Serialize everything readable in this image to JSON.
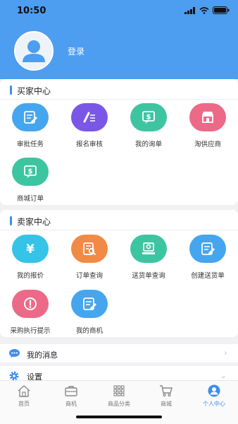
{
  "status": {
    "time": "10:50"
  },
  "profile": {
    "login_label": "登录"
  },
  "buyer": {
    "title": "买家中心",
    "items": [
      {
        "label": "审批任务",
        "icon": "approval-icon",
        "color": "#45a6ef"
      },
      {
        "label": "报名审核",
        "icon": "signup-review-icon",
        "color": "#7a57e6"
      },
      {
        "label": "我的询单",
        "icon": "inquiry-icon",
        "color": "#3dc5a2"
      },
      {
        "label": "淘供应商",
        "icon": "store-icon",
        "color": "#ec6a88"
      },
      {
        "label": "商城订单",
        "icon": "mall-order-icon",
        "color": "#3dc5a2"
      }
    ]
  },
  "seller": {
    "title": "卖家中心",
    "items": [
      {
        "label": "我的报价",
        "icon": "yen-icon",
        "color": "#35c3e8"
      },
      {
        "label": "订单查询",
        "icon": "order-search-icon",
        "color": "#f08a45"
      },
      {
        "label": "送货单查询",
        "icon": "delivery-search-icon",
        "color": "#3dc5a2"
      },
      {
        "label": "创建送货单",
        "icon": "create-delivery-icon",
        "color": "#45a6ef"
      },
      {
        "label": "采购执行提示",
        "icon": "alert-icon",
        "color": "#ec6a88"
      },
      {
        "label": "我的商机",
        "icon": "opportunity-icon",
        "color": "#45a6ef"
      }
    ]
  },
  "menu": {
    "messages": {
      "label": "我的消息",
      "arrow": "›"
    },
    "settings": {
      "label": "设置",
      "arrow": "⌄"
    }
  },
  "tabbar": {
    "tabs": [
      {
        "label": "首页",
        "icon": "home-icon"
      },
      {
        "label": "商机",
        "icon": "briefcase-icon"
      },
      {
        "label": "商品分类",
        "icon": "grid-icon"
      },
      {
        "label": "商城",
        "icon": "cart-icon"
      },
      {
        "label": "个人中心",
        "icon": "person-icon",
        "active": true
      }
    ]
  }
}
